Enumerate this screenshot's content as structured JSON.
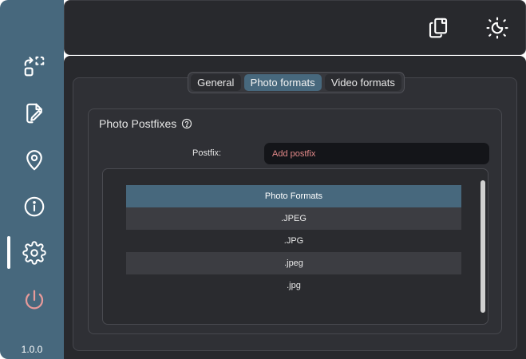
{
  "sidebar": {
    "items": [
      {
        "icon": "transfer-icon"
      },
      {
        "icon": "edit-file-icon"
      },
      {
        "icon": "location-pin-icon"
      },
      {
        "icon": "info-icon"
      },
      {
        "icon": "gear-icon",
        "active": true
      },
      {
        "icon": "power-icon"
      }
    ],
    "version": "1.0.0"
  },
  "topbar": {
    "icons": [
      "copy-icon",
      "theme-toggle-icon"
    ]
  },
  "tabs": [
    {
      "label": "General"
    },
    {
      "label": "Photo formats",
      "active": true
    },
    {
      "label": "Video formats"
    }
  ],
  "card": {
    "title": "Photo Postfixes",
    "postfix_label": "Postfix:",
    "postfix_placeholder": "Add postfix"
  },
  "table": {
    "header": "Photo Formats",
    "rows": [
      ".JPEG",
      ".JPG",
      ".jpeg",
      ".jpg"
    ]
  },
  "colors": {
    "accent": "#47687d",
    "background": "#28292d",
    "panel": "#2f3035",
    "power": "#e79a9a",
    "placeholder": "#e48a8a"
  }
}
